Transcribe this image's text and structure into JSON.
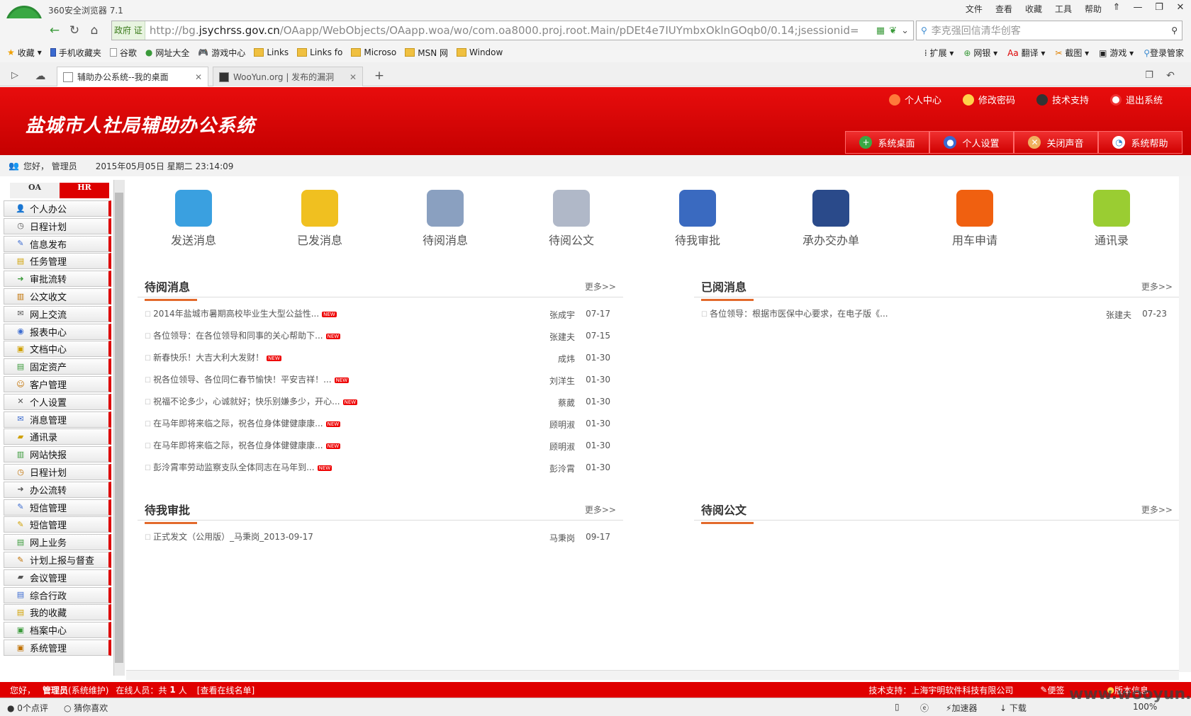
{
  "browser": {
    "app_name": "360安全浏览器 7.1",
    "menu": [
      "文件",
      "查看",
      "收藏",
      "工具",
      "帮助"
    ],
    "window_controls": [
      "⇑",
      "—",
      "❐",
      "✕"
    ],
    "url_badge": "政府 证",
    "url_prefix": "http://bg.",
    "url_domain": "jsychrss.gov.cn",
    "url_rest": "/OAapp/WebObjects/OAapp.woa/wo/com.oa8000.proj.root.Main/pDEt4e7IUYmbxOklnGOqb0/0.14;jsessionid=",
    "search_placeholder": "李克强回信清华创客",
    "bookmarks": [
      "收藏",
      "手机收藏夹",
      "谷歌",
      "网址大全",
      "游戏中心",
      "Links",
      "Links fo",
      "Microso",
      "MSN 网",
      "Window"
    ],
    "toolbar_right": [
      "扩展",
      "网银",
      "翻译",
      "截图",
      "游戏",
      "登录管家"
    ],
    "tabs": [
      {
        "label": "辅助办公系统--我的桌面"
      },
      {
        "label": "WooYun.org | 发布的漏洞"
      }
    ],
    "new_tab": "+"
  },
  "app": {
    "title": "盐城市人社局辅助办公系统",
    "top_links": [
      "个人中心",
      "修改密码",
      "技术支持",
      "退出系统"
    ],
    "header_tabs": [
      "系统桌面",
      "个人设置",
      "关闭声音",
      "系统帮助"
    ],
    "greeting": "您好， 管理员",
    "datetime": "2015年05月05日 星期二 23:14:09"
  },
  "sidebar": {
    "tabs": [
      "OA",
      "HR"
    ],
    "items": [
      "个人办公",
      "日程计划",
      "信息发布",
      "任务管理",
      "审批流转",
      "公文收文",
      "网上交流",
      "报表中心",
      "文档中心",
      "固定资产",
      "客户管理",
      "个人设置",
      "消息管理",
      "通讯录",
      "网站快报",
      "日程计划",
      "办公流转",
      "短信管理",
      "短信管理",
      "网上业务",
      "计划上报与督查",
      "会议管理",
      "综合行政",
      "我的收藏",
      "档案中心",
      "系统管理"
    ]
  },
  "quick_icons": [
    {
      "label": "发送消息",
      "color": "#3aa0e0"
    },
    {
      "label": "已发消息",
      "color": "#f0c020"
    },
    {
      "label": "待阅消息",
      "color": "#8aa0c0"
    },
    {
      "label": "待阅公文",
      "color": "#b0b8c8"
    },
    {
      "label": "待我审批",
      "color": "#3a6ac0"
    },
    {
      "label": "承办交办单",
      "color": "#2a4a8a"
    },
    {
      "label": "用车申请",
      "color": "#f06010"
    },
    {
      "label": "通讯录",
      "color": "#9acd32"
    }
  ],
  "panels": {
    "unread": {
      "title": "待阅消息",
      "more": "更多>>",
      "rows": [
        {
          "text": "2014年盐城市暑期高校毕业生大型公益性...",
          "author": "张成宇",
          "date": "07-17",
          "new": "NEW"
        },
        {
          "text": "各位领导：在各位领导和同事的关心帮助下...",
          "author": "张建夫",
          "date": "07-15",
          "new": "NEW"
        },
        {
          "text": "新春快乐！大吉大利大发财！",
          "author": "成炜",
          "date": "01-30",
          "new": "NEW"
        },
        {
          "text": "祝各位领导、各位同仁春节愉快！平安吉祥！...",
          "author": "刘洋生",
          "date": "01-30",
          "new": "NEW"
        },
        {
          "text": "祝福不论多少，心诚就好；快乐别嫌多少，开心...",
          "author": "蔡葳",
          "date": "01-30",
          "new": "NEW"
        },
        {
          "text": "在马年即将来临之际，祝各位身体健健康康...",
          "author": "顾明淑",
          "date": "01-30",
          "new": "NEW"
        },
        {
          "text": "在马年即将来临之际，祝各位身体健健康康...",
          "author": "顾明淑",
          "date": "01-30",
          "new": "NEW"
        },
        {
          "text": "彭泠霄率劳动监察支队全体同志在马年到...",
          "author": "彭泠霄",
          "date": "01-30",
          "new": "NEW"
        }
      ]
    },
    "read": {
      "title": "已阅消息",
      "more": "更多>>",
      "rows": [
        {
          "text": "各位领导：根据市医保中心要求，在电子版《...",
          "author": "张建夫",
          "date": "07-23"
        }
      ]
    },
    "approve": {
      "title": "待我审批",
      "more": "更多>>",
      "rows": [
        {
          "text": "正式发文（公用版）_马秉岗_2013-09-17",
          "author": "马秉岗",
          "date": "09-17"
        }
      ]
    },
    "docs": {
      "title": "待阅公文",
      "more": "更多>>",
      "rows": []
    }
  },
  "footer": {
    "hello": "您好，",
    "user": "管理员",
    "role": "(系统维护)",
    "online": "在线人员：共",
    "online_count": "1",
    "online_unit": "人",
    "view_list": "[查看在线名单]",
    "support": "技术支持：上海宇明软件科技有限公司",
    "notes": "便签",
    "version": "版本信息"
  },
  "status": {
    "comments": "0个点评",
    "guess": "猜你喜欢",
    "accelerate": "加速器",
    "download": "下载",
    "zoom": "100%",
    "watermark": "www.wooyun.org"
  }
}
